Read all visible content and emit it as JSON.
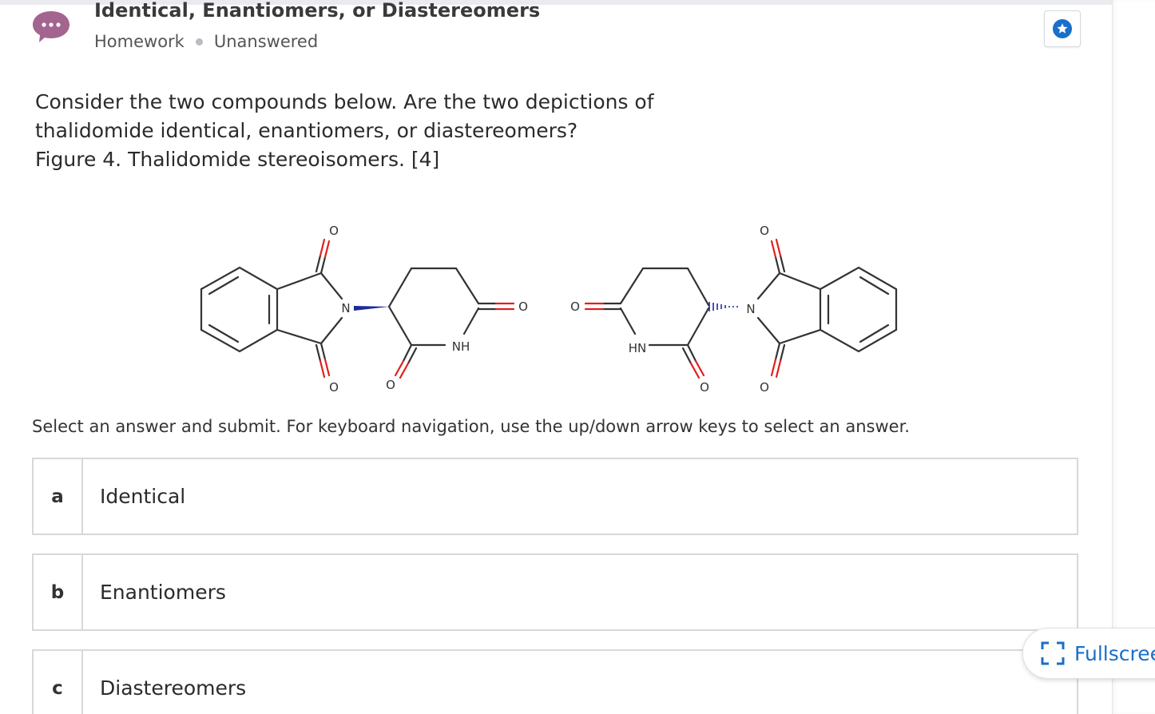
{
  "header": {
    "title": "Identical, Enantiomers, or Diastereomers",
    "type": "Homework",
    "status": "Unanswered"
  },
  "question": {
    "line1": "Consider the two compounds below. Are the two depictions of",
    "line2": "thalidomide identical, enantiomers, or diastereomers?",
    "caption": "Figure 4. Thalidomide stereoisomers. [4]"
  },
  "molecule_labels": {
    "oxygen": "O",
    "nitrogen": "N",
    "nh": "NH",
    "hn": "HN"
  },
  "instructions": "Select an answer and submit. For keyboard navigation, use the up/down arrow keys to select an answer.",
  "answers": [
    {
      "letter": "a",
      "label": "Identical"
    },
    {
      "letter": "b",
      "label": "Enantiomers"
    },
    {
      "letter": "c",
      "label": "Diastereomers"
    }
  ],
  "fullscreen_label": "Fullscreen",
  "colors": {
    "accent": "#1a6fc9",
    "badge": "#a3658f",
    "oxygen_bond": "#e0201c",
    "nitrogen_wedge": "#1c2b99"
  }
}
